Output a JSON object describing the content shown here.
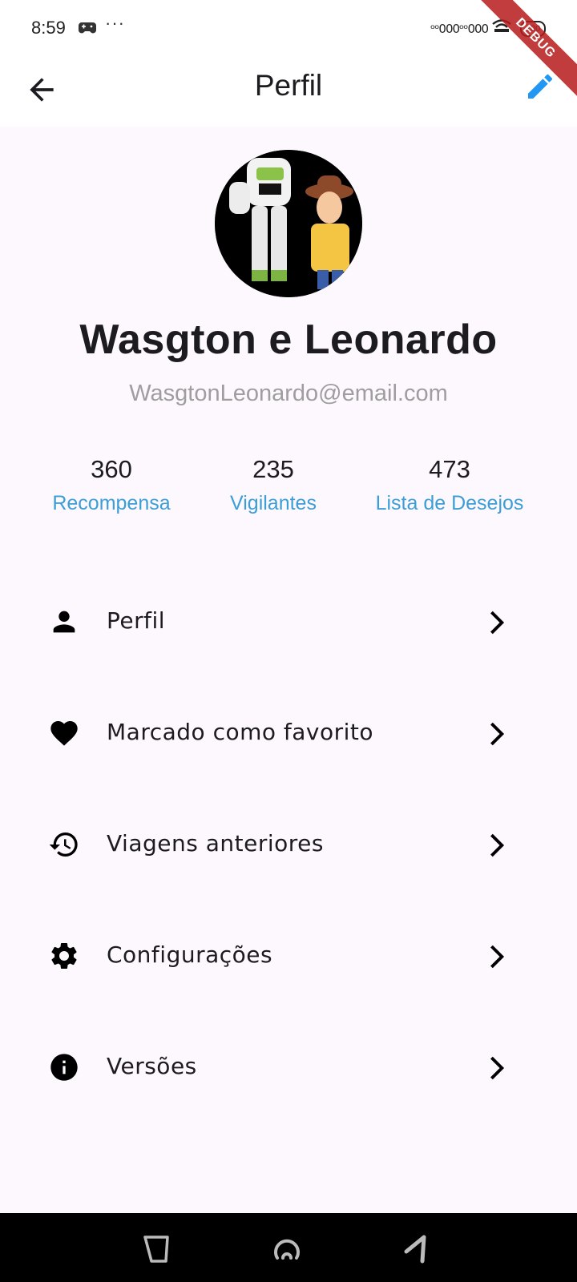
{
  "status_bar": {
    "time": "8:59",
    "dots": "···",
    "signal": "ᵒᵒ000ᵒᵒ000",
    "battery": "100",
    "icons": [
      "game-controller-icon",
      "signal-icon",
      "wifi-icon",
      "battery-icon"
    ]
  },
  "debug_banner": "DEBUG",
  "app_bar": {
    "title": "Perfil",
    "back_icon": "arrow-back-icon",
    "edit_icon": "edit-pencil-icon",
    "accent_color": "#2196f3"
  },
  "profile": {
    "name": "Wasgton e Leonardo",
    "email": "WasgtonLeonardo@email.com"
  },
  "stats": [
    {
      "value": "360",
      "label": "Recompensa"
    },
    {
      "value": "235",
      "label": "Vigilantes"
    },
    {
      "value": "473",
      "label": "Lista de Desejos"
    }
  ],
  "menu": [
    {
      "label": "Perfil",
      "icon": "person-icon"
    },
    {
      "label": "Marcado como favorito",
      "icon": "heart-icon"
    },
    {
      "label": "Viagens anteriores",
      "icon": "history-icon"
    },
    {
      "label": "Configurações",
      "icon": "settings-gear-icon"
    },
    {
      "label": "Versões",
      "icon": "info-icon"
    }
  ],
  "colors": {
    "background": "#fdf8fd",
    "link": "#3b9ed6",
    "email": "#9e9e9e"
  }
}
